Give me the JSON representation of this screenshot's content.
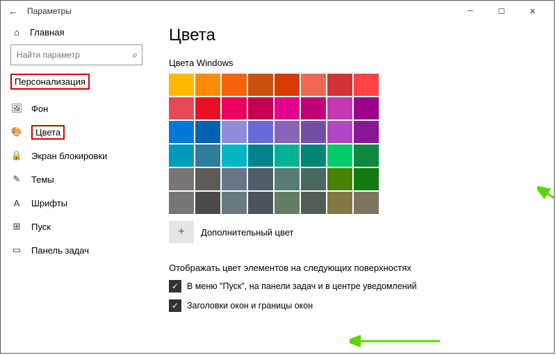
{
  "titlebar": {
    "back": "←",
    "title": "Параметры"
  },
  "sidebar": {
    "home": "Главная",
    "search_placeholder": "Найти параметр",
    "category": "Персонализация",
    "items": [
      {
        "icon": "🖼",
        "label": "Фон"
      },
      {
        "icon": "🎨",
        "label": "Цвета"
      },
      {
        "icon": "🔒",
        "label": "Экран блокировки"
      },
      {
        "icon": "✎",
        "label": "Темы"
      },
      {
        "icon": "A",
        "label": "Шрифты"
      },
      {
        "icon": "⊞",
        "label": "Пуск"
      },
      {
        "icon": "▭",
        "label": "Панель задач"
      }
    ]
  },
  "main": {
    "heading": "Цвета",
    "swatch_title": "Цвета Windows",
    "more_color": "Дополнительный цвет",
    "surfaces_heading": "Отображать цвет элементов на следующих поверхностях",
    "chk1": "В меню \"Пуск\", на панели задач и в центре уведомлений",
    "chk2": "Заголовки окон и границы окон"
  },
  "colors": [
    [
      "#ffb900",
      "#ff8c00",
      "#f7630c",
      "#ca5010",
      "#da3b01",
      "#ef6950",
      "#d13438",
      "#ff4343"
    ],
    [
      "#e74856",
      "#e81123",
      "#ea005e",
      "#c30052",
      "#e3008c",
      "#bf0077",
      "#c239b3",
      "#9a0089"
    ],
    [
      "#0078d7",
      "#0063b1",
      "#8e8cd8",
      "#6b69d6",
      "#8764b8",
      "#744da9",
      "#b146c2",
      "#881798"
    ],
    [
      "#0099bc",
      "#2d7d9a",
      "#00b7c3",
      "#038387",
      "#00b294",
      "#018574",
      "#00cc6a",
      "#10893e"
    ],
    [
      "#7a7574",
      "#5d5a58",
      "#68768a",
      "#515c6b",
      "#567c73",
      "#486860",
      "#498205",
      "#107c10"
    ],
    [
      "#767676",
      "#4c4a48",
      "#69797e",
      "#4a5459",
      "#647c64",
      "#525e54",
      "#847545",
      "#7e735f"
    ]
  ]
}
